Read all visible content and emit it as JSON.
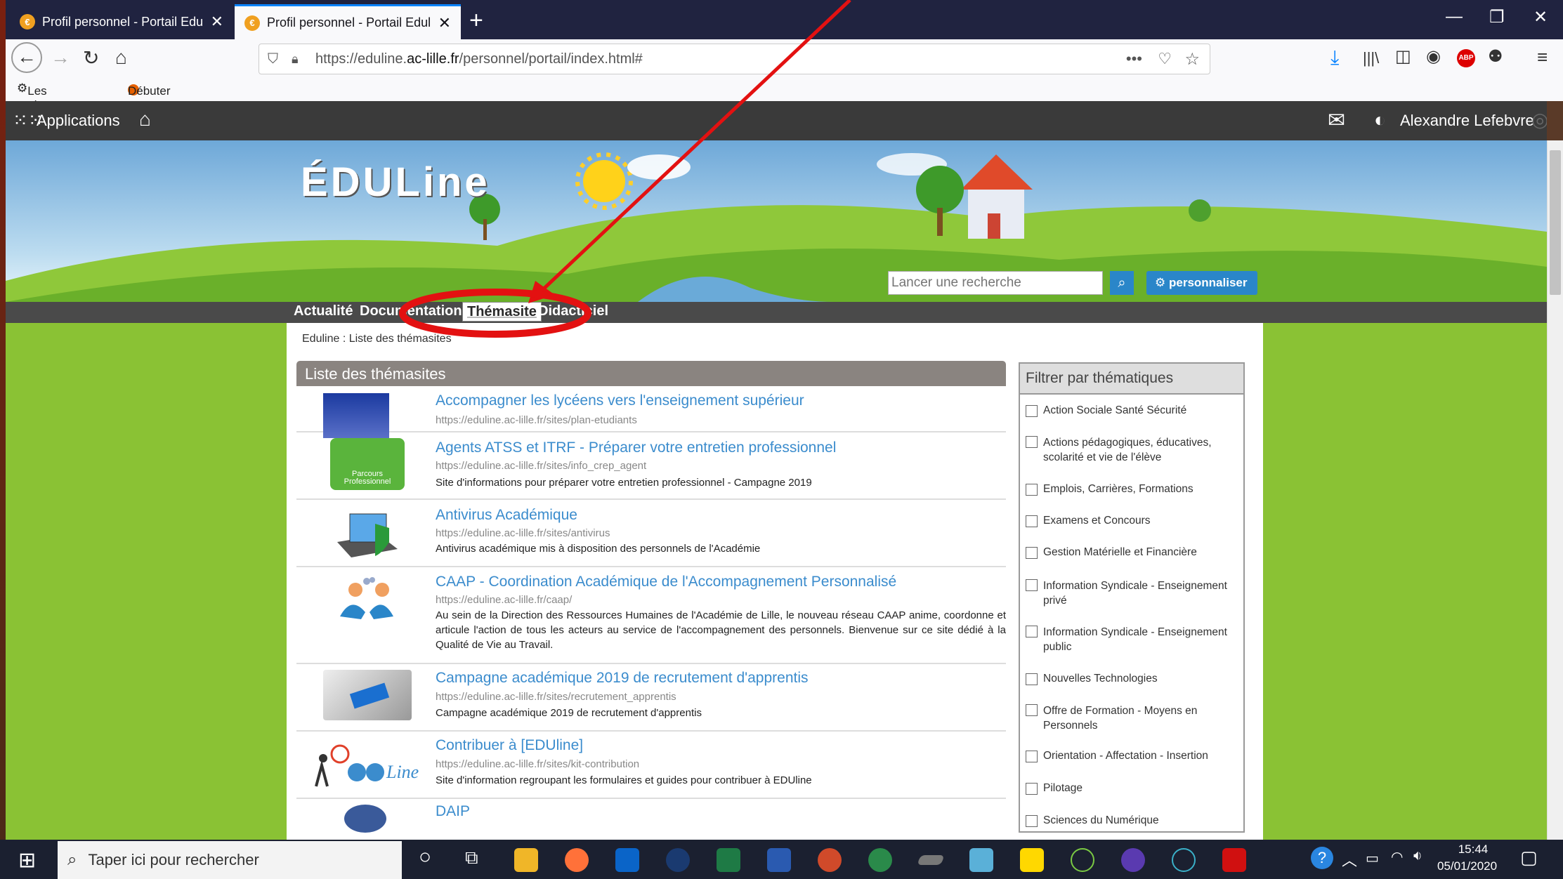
{
  "browser": {
    "tabs": [
      {
        "label": "Profil personnel - Portail Eduline"
      },
      {
        "label": "Profil personnel - Portail Eduline"
      }
    ],
    "url_prefix": "https://eduline.",
    "url_domain": "ac-lille.fr",
    "url_path": "/personnel/portail/index.html#",
    "bookmarks": [
      "Les plus visités",
      "Débuter avec Firefox"
    ]
  },
  "appbar": {
    "apps_label": "Applications",
    "user_name": "Alexandre Lefebvre"
  },
  "banner": {
    "logo_text": "ÉDULine",
    "search_placeholder": "Lancer une recherche",
    "personalize_label": "personnaliser"
  },
  "menu": [
    "Actualité",
    "Documentation",
    "Thémasite",
    "Didacticiel"
  ],
  "breadcrumb": "Eduline : Liste des thémasites",
  "list_title": "Liste des thémasites",
  "items": [
    {
      "title": "Accompagner les lycéens vers l'enseignement supérieur",
      "url": "https://eduline.ac-lille.fr/sites/plan-etudiants",
      "desc": ""
    },
    {
      "title": "Agents ATSS et ITRF - Préparer votre entretien professionnel",
      "url": "https://eduline.ac-lille.fr/sites/info_crep_agent",
      "desc": "Site d'informations pour préparer votre entretien professionnel - Campagne 2019",
      "thumb_text": "Parcours Professionnel"
    },
    {
      "title": "Antivirus Académique",
      "url": "https://eduline.ac-lille.fr/sites/antivirus",
      "desc": "Antivirus académique mis à disposition des personnels de l'Académie"
    },
    {
      "title": "CAAP - Coordination Académique de l'Accompagnement Personnalisé",
      "url": "https://eduline.ac-lille.fr/caap/",
      "desc": "Au sein de la Direction des Ressources Humaines de l'Académie de Lille, le nouveau réseau CAAP anime, coordonne et articule l'action de tous les acteurs au service de l'accompagnement des personnels. Bienvenue sur ce site dédié à la Qualité de Vie au Travail."
    },
    {
      "title": "Campagne académique 2019 de recrutement d'apprentis",
      "url": "https://eduline.ac-lille.fr/sites/recrutement_apprentis",
      "desc": "Campagne académique 2019 de recrutement d'apprentis"
    },
    {
      "title": "Contribuer à [EDUline]",
      "url": "https://eduline.ac-lille.fr/sites/kit-contribution",
      "desc": "Site d'information regroupant les formulaires et guides pour contribuer à EDUline"
    },
    {
      "title": "DAIP",
      "url": "",
      "desc": ""
    }
  ],
  "filter": {
    "title": "Filtrer par thématiques",
    "options": [
      "Action Sociale Santé Sécurité",
      "Actions pédagogiques, éducatives, scolarité et vie de l'élève",
      "Emplois, Carrières, Formations",
      "Examens et Concours",
      "Gestion Matérielle et Financière",
      "Information Syndicale - Enseignement privé",
      "Information Syndicale - Enseignement public",
      "Nouvelles Technologies",
      "Offre de Formation - Moyens en Personnels",
      "Orientation - Affectation - Insertion",
      "Pilotage",
      "Sciences du Numérique"
    ]
  },
  "taskbar": {
    "search_placeholder": "Taper ici pour rechercher",
    "time": "15:44",
    "date": "05/01/2020"
  },
  "colors": {
    "annotation_red": "#e31111",
    "link_blue": "#3b8ccd",
    "page_green": "#8ac234",
    "tab_dark": "#202340"
  }
}
